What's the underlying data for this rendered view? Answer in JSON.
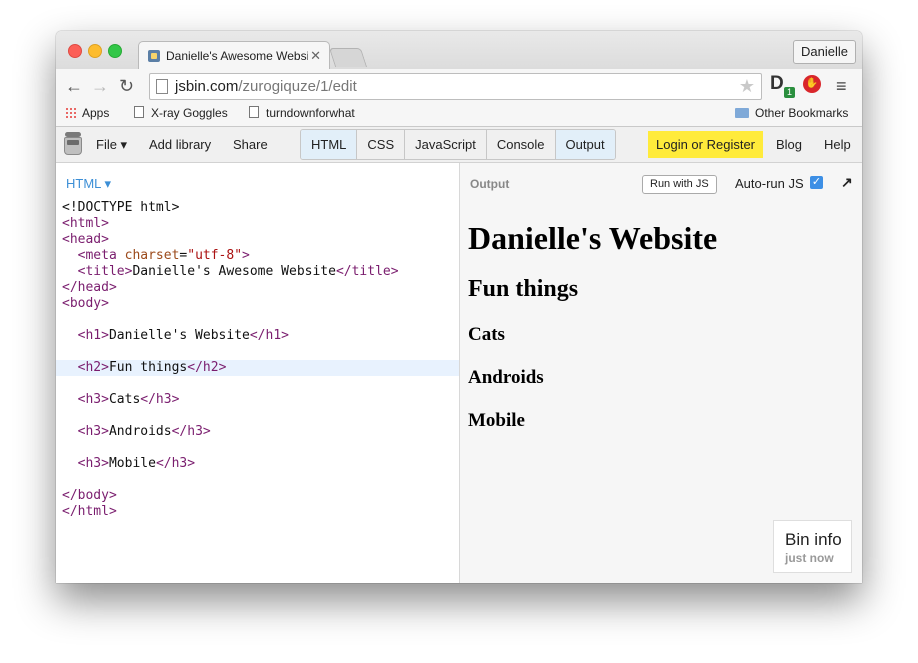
{
  "browser": {
    "tab_title": "Danielle's Awesome Websi",
    "profile": "Danielle",
    "url_host": "jsbin.com",
    "url_path": "/zurogiquze/1/edit",
    "ext_badge": "1",
    "bookmarks": [
      "Apps",
      "X-ray Goggles",
      "turndownforwhat"
    ],
    "other_bookmarks": "Other Bookmarks"
  },
  "jsbin": {
    "menu": {
      "file": "File ▾",
      "add_library": "Add library",
      "share": "Share"
    },
    "panels": [
      "HTML",
      "CSS",
      "JavaScript",
      "Console",
      "Output"
    ],
    "login": "Login or Register",
    "blog": "Blog",
    "help": "Help"
  },
  "editor": {
    "label": "HTML ▾",
    "lines": [
      "<!DOCTYPE html>",
      "<html>",
      "<head>",
      "  <meta charset=\"utf-8\">",
      "  <title>Danielle's Awesome Website</title>",
      "</head>",
      "<body>",
      "",
      "  <h1>Danielle's Website</h1>",
      "",
      "  <h2>Fun things</h2>",
      "",
      "  <h3>Cats</h3>",
      "",
      "  <h3>Androids</h3>",
      "",
      "  <h3>Mobile</h3>",
      "",
      "</body>",
      "</html>"
    ],
    "highlighted_line": 10
  },
  "output": {
    "label": "Output",
    "run_button": "Run with JS",
    "autorun_label": "Auto-run JS",
    "autorun_checked": true,
    "h1": "Danielle's Website",
    "h2": "Fun things",
    "h3": [
      "Cats",
      "Androids",
      "Mobile"
    ],
    "bin_info_title": "Bin info",
    "bin_info_time": "just now"
  }
}
